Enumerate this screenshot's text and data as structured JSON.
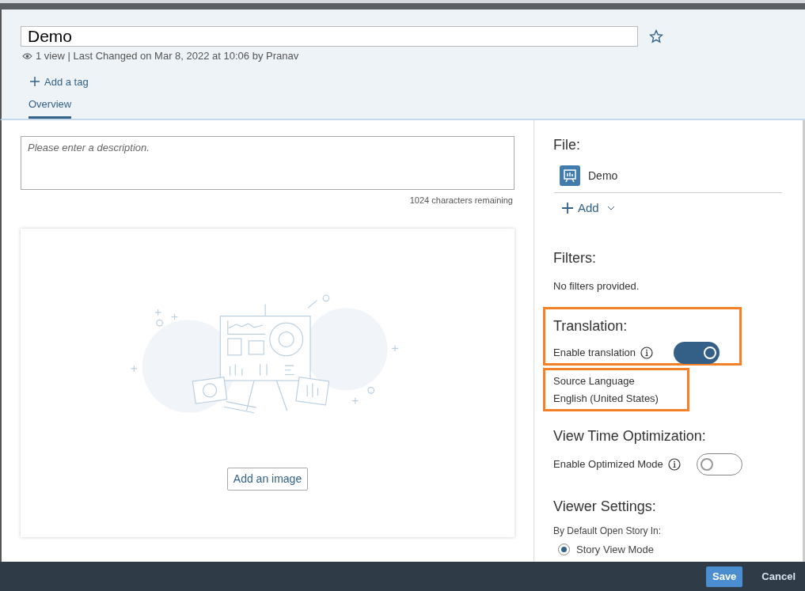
{
  "header": {
    "title": "Demo",
    "favorite": false,
    "meta": "1 view | Last Changed on Mar 8, 2022 at 10:06 by Pranav",
    "add_tag": "Add a tag"
  },
  "tabs": [
    {
      "label": "Overview",
      "selected": true
    }
  ],
  "description": {
    "placeholder": "Please enter a description.",
    "remaining": "1024 characters remaining"
  },
  "image": {
    "button": "Add an image"
  },
  "file": {
    "heading": "File:",
    "name": "Demo",
    "add": "Add"
  },
  "filters": {
    "heading": "Filters:",
    "text": "No filters provided."
  },
  "translation": {
    "heading": "Translation:",
    "label": "Enable translation",
    "on": true,
    "highlighted": true
  },
  "source_language": {
    "label": "Source Language",
    "value": "English (United States)",
    "highlighted": true
  },
  "optimization": {
    "heading": "View Time Optimization:",
    "label": "Enable Optimized Mode",
    "on": false
  },
  "viewer": {
    "heading": "Viewer Settings:",
    "label": "By Default Open Story In:",
    "options": [
      {
        "label": "Story View Mode",
        "selected": true
      }
    ]
  },
  "footer": {
    "buttons": [
      "Save",
      "Cancel"
    ]
  }
}
